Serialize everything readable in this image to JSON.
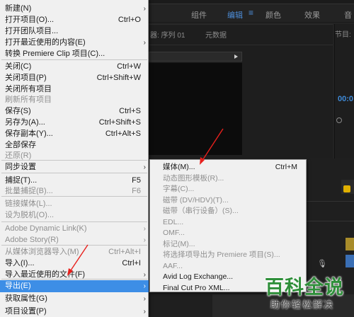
{
  "workspace_tabs": {
    "components": "组件",
    "editing": "编辑",
    "editing_menu": "≡",
    "color": "颜色",
    "effects": "效果",
    "audio": "音"
  },
  "source_panel": {
    "title": "器: 序列 01",
    "metadata_tab": "元数据"
  },
  "program_panel": {
    "title": "节目:",
    "timecode": "00:0"
  },
  "file_menu": {
    "items": [
      {
        "label": "新建(N)",
        "shortcut": "",
        "submenu": true,
        "disabled": false
      },
      {
        "label": "打开项目(O)...",
        "shortcut": "Ctrl+O",
        "submenu": false,
        "disabled": false
      },
      {
        "label": "打开团队项目...",
        "shortcut": "",
        "submenu": false,
        "disabled": false
      },
      {
        "label": "打开最近使用的内容(E)",
        "shortcut": "",
        "submenu": true,
        "disabled": false
      },
      {
        "label": "转换 Premiere Clip 项目(C)...",
        "shortcut": "",
        "submenu": false,
        "disabled": false
      },
      {
        "label": "关闭(C)",
        "shortcut": "Ctrl+W",
        "submenu": false,
        "disabled": false
      },
      {
        "label": "关闭项目(P)",
        "shortcut": "Ctrl+Shift+W",
        "submenu": false,
        "disabled": false
      },
      {
        "label": "关闭所有项目",
        "shortcut": "",
        "submenu": false,
        "disabled": false
      },
      {
        "label": "刷新所有项目",
        "shortcut": "",
        "submenu": false,
        "disabled": true
      },
      {
        "label": "保存(S)",
        "shortcut": "Ctrl+S",
        "submenu": false,
        "disabled": false
      },
      {
        "label": "另存为(A)...",
        "shortcut": "Ctrl+Shift+S",
        "submenu": false,
        "disabled": false
      },
      {
        "label": "保存副本(Y)...",
        "shortcut": "Ctrl+Alt+S",
        "submenu": false,
        "disabled": false
      },
      {
        "label": "全部保存",
        "shortcut": "",
        "submenu": false,
        "disabled": false
      },
      {
        "label": "还原(R)",
        "shortcut": "",
        "submenu": false,
        "disabled": true
      },
      {
        "label": "同步设置",
        "shortcut": "",
        "submenu": true,
        "disabled": false
      },
      {
        "label": "捕捉(T)...",
        "shortcut": "F5",
        "submenu": false,
        "disabled": false
      },
      {
        "label": "批量捕捉(B)...",
        "shortcut": "F6",
        "submenu": false,
        "disabled": true
      },
      {
        "label": "链接媒体(L)...",
        "shortcut": "",
        "submenu": false,
        "disabled": true
      },
      {
        "label": "设为脱机(O)...",
        "shortcut": "",
        "submenu": false,
        "disabled": true
      },
      {
        "label": "Adobe Dynamic Link(K)",
        "shortcut": "",
        "submenu": true,
        "disabled": true
      },
      {
        "label": "Adobe Story(R)",
        "shortcut": "",
        "submenu": true,
        "disabled": true
      },
      {
        "label": "从媒体浏览器导入(M)",
        "shortcut": "Ctrl+Alt+I",
        "submenu": false,
        "disabled": true
      },
      {
        "label": "导入(I)...",
        "shortcut": "Ctrl+I",
        "submenu": false,
        "disabled": false
      },
      {
        "label": "导入最近使用的文件(F)",
        "shortcut": "",
        "submenu": true,
        "disabled": false
      },
      {
        "label": "导出(E)",
        "shortcut": "",
        "submenu": true,
        "disabled": false,
        "highlighted": true
      },
      {
        "label": "获取属性(G)",
        "shortcut": "",
        "submenu": true,
        "disabled": false
      },
      {
        "label": "项目设置(P)",
        "shortcut": "",
        "submenu": true,
        "disabled": false
      }
    ]
  },
  "export_submenu": {
    "items": [
      {
        "label": "媒体(M)...",
        "shortcut": "Ctrl+M",
        "disabled": false
      },
      {
        "label": "动态图形模板(R)...",
        "shortcut": "",
        "disabled": true
      },
      {
        "label": "字幕(C)...",
        "shortcut": "",
        "disabled": true
      },
      {
        "label": "磁带 (DV/HDV)(T)...",
        "shortcut": "",
        "disabled": true
      },
      {
        "label": "磁带（串行设备）(S)...",
        "shortcut": "",
        "disabled": true
      },
      {
        "label": "EDL...",
        "shortcut": "",
        "disabled": true
      },
      {
        "label": "OMF...",
        "shortcut": "",
        "disabled": true
      },
      {
        "label": "标记(M)...",
        "shortcut": "",
        "disabled": true
      },
      {
        "label": "将选择项导出为 Premiere 项目(S)...",
        "shortcut": "",
        "disabled": true
      },
      {
        "label": "AAF...",
        "shortcut": "",
        "disabled": true
      },
      {
        "label": "Avid Log Exchange...",
        "shortcut": "",
        "disabled": false
      },
      {
        "label": "Final Cut Pro XML...",
        "shortcut": "",
        "disabled": false
      }
    ]
  },
  "watermark": {
    "title": "百科全说",
    "subtitle": "助你轻松解决"
  },
  "colors": {
    "highlight": "#3d8ee6",
    "menu_bg": "#f0f0f0",
    "disabled_text": "#8f8f8f",
    "annotation_arrow": "#e8201c",
    "watermark_green": "#2f8f3a"
  }
}
